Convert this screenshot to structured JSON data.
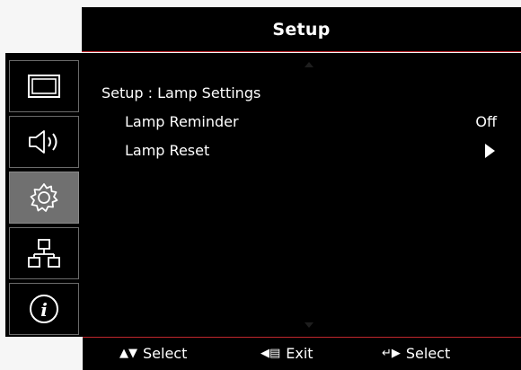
{
  "header": {
    "title": "Setup"
  },
  "sidebar": {
    "items": [
      {
        "name": "display",
        "icon": "display-icon",
        "active": false
      },
      {
        "name": "audio",
        "icon": "speaker-icon",
        "active": false
      },
      {
        "name": "setup",
        "icon": "gear-icon",
        "active": true
      },
      {
        "name": "network",
        "icon": "network-icon",
        "active": false
      },
      {
        "name": "info",
        "icon": "info-icon",
        "active": false
      }
    ]
  },
  "main": {
    "breadcrumb": "Setup : Lamp Settings",
    "rows": [
      {
        "label": "Lamp Reminder",
        "value": "Off"
      },
      {
        "label": "Lamp Reset",
        "value_icon": "triangle-right-icon"
      }
    ]
  },
  "footer": {
    "hints": [
      {
        "glyph": "▲▼",
        "label": "Select"
      },
      {
        "glyph": "◀▤",
        "label": "Exit"
      },
      {
        "glyph": "↵▶",
        "label": "Select"
      }
    ]
  },
  "colors": {
    "accent": "#c0272d",
    "background": "#000000",
    "active_tab": "#707070"
  }
}
